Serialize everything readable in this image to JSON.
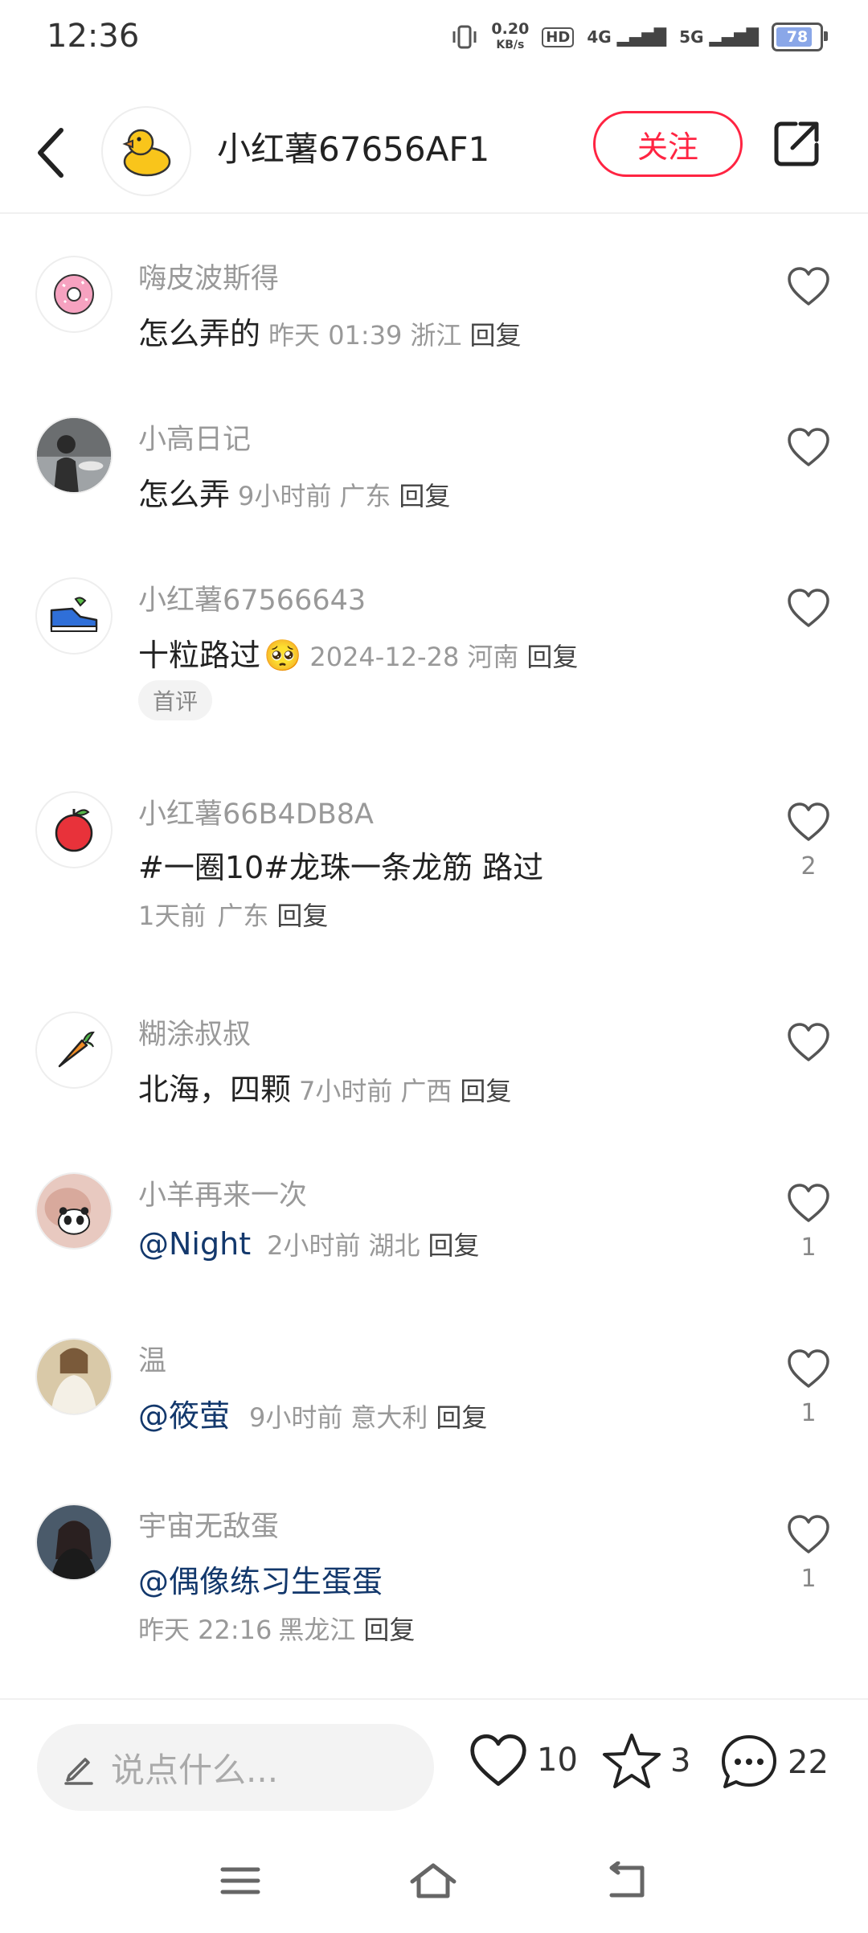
{
  "status_bar": {
    "time": "12:36",
    "net_speed_value": "0.20",
    "net_speed_unit": "KB/s",
    "hd": "HD",
    "sim1": "4G",
    "sim2": "5G",
    "battery": "78"
  },
  "header": {
    "author_name": "小红薯67656AF1",
    "follow_label": "关注"
  },
  "comments": [
    {
      "nickname": "嗨皮波斯得",
      "text": "怎么弄的",
      "time": "昨天 01:39",
      "location": "浙江",
      "reply": "回复",
      "likes": ""
    },
    {
      "nickname": "小高日记",
      "text": "怎么弄",
      "time": "9小时前",
      "location": "广东",
      "reply": "回复",
      "likes": ""
    },
    {
      "nickname": "小红薯67566643",
      "text": "十粒路过",
      "emoji": "🥺",
      "time": "2024-12-28",
      "location": "河南",
      "reply": "回复",
      "tag": "首评",
      "likes": ""
    },
    {
      "nickname": "小红薯66B4DB8A",
      "text": "#一圈10#龙珠一条龙筋 路过",
      "time": "1天前",
      "location": "广东",
      "reply": "回复",
      "likes": "2"
    },
    {
      "nickname": "糊涂叔叔",
      "text": "北海，四颗",
      "time": "7小时前",
      "location": "广西",
      "reply": "回复",
      "likes": ""
    },
    {
      "nickname": "小羊再来一次",
      "mention": "@Night",
      "time": "2小时前",
      "location": "湖北",
      "reply": "回复",
      "likes": "1"
    },
    {
      "nickname": "温",
      "mention": "@筱萤",
      "time": "9小时前",
      "location": "意大利",
      "reply": "回复",
      "likes": "1"
    },
    {
      "nickname": "宇宙无敌蛋",
      "mention": "@偶像练习生蛋蛋",
      "time": "昨天 22:16",
      "location": "黑龙江",
      "reply": "回复",
      "likes": "1"
    }
  ],
  "bottom_bar": {
    "placeholder": "说点什么...",
    "likes": "10",
    "stars": "3",
    "comments": "22"
  },
  "colors": {
    "accent": "#ff2442",
    "mention": "#13386c",
    "meta": "#999999"
  },
  "icons": [
    "back-icon",
    "duck-icon",
    "share-icon",
    "heart-icon",
    "star-icon",
    "chat-icon",
    "pen-icon",
    "menu-icon",
    "home-icon",
    "back-nav-icon"
  ]
}
